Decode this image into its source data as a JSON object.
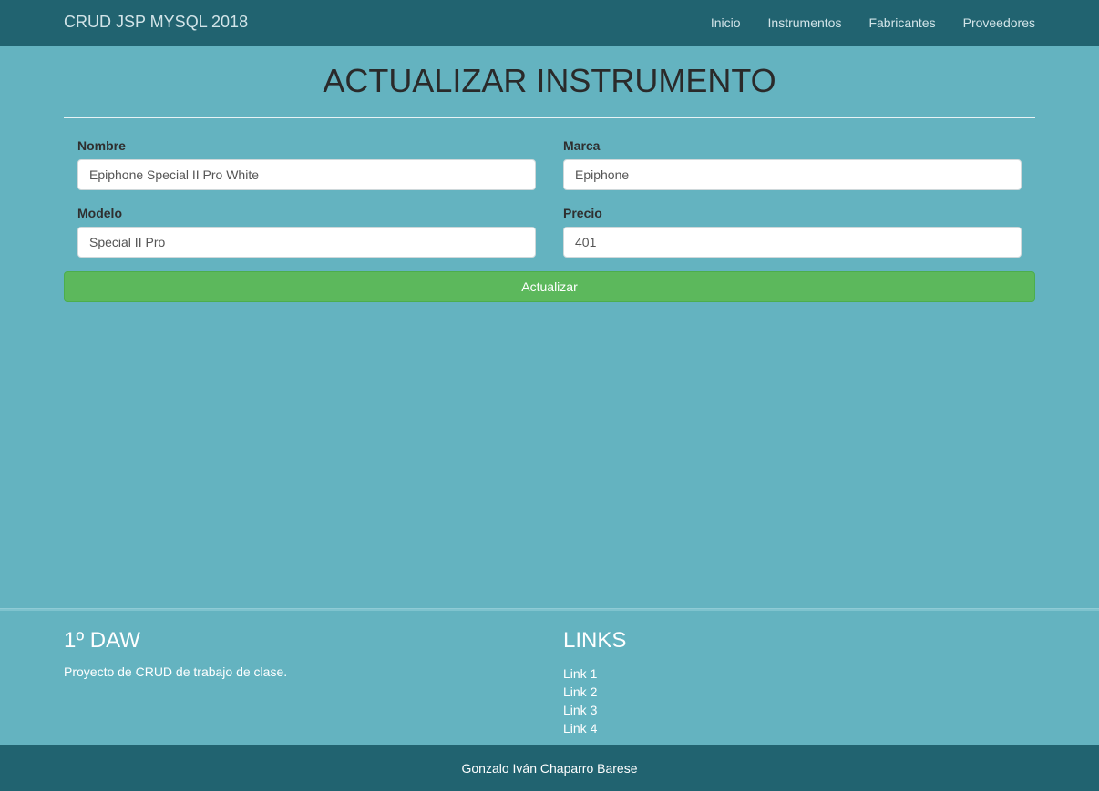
{
  "navbar": {
    "brand": "CRUD JSP MYSQL 2018",
    "links": [
      "Inicio",
      "Instrumentos",
      "Fabricantes",
      "Proveedores"
    ]
  },
  "page": {
    "title": "ACTUALIZAR INSTRUMENTO"
  },
  "form": {
    "nombre": {
      "label": "Nombre",
      "value": "Epiphone Special II Pro White"
    },
    "marca": {
      "label": "Marca",
      "value": "Epiphone"
    },
    "modelo": {
      "label": "Modelo",
      "value": "Special II Pro"
    },
    "precio": {
      "label": "Precio",
      "value": "401"
    },
    "submit_label": "Actualizar"
  },
  "footer": {
    "left_heading": "1º DAW",
    "left_text": "Proyecto de CRUD de trabajo de clase.",
    "right_heading": "LINKS",
    "links": [
      "Link 1",
      "Link 2",
      "Link 3",
      "Link 4"
    ]
  },
  "bottom_bar": {
    "credit": "Gonzalo Iván Chaparro Barese"
  },
  "colors": {
    "navbar": "#216370",
    "background": "#64b3c0",
    "button": "#5cb85c"
  }
}
